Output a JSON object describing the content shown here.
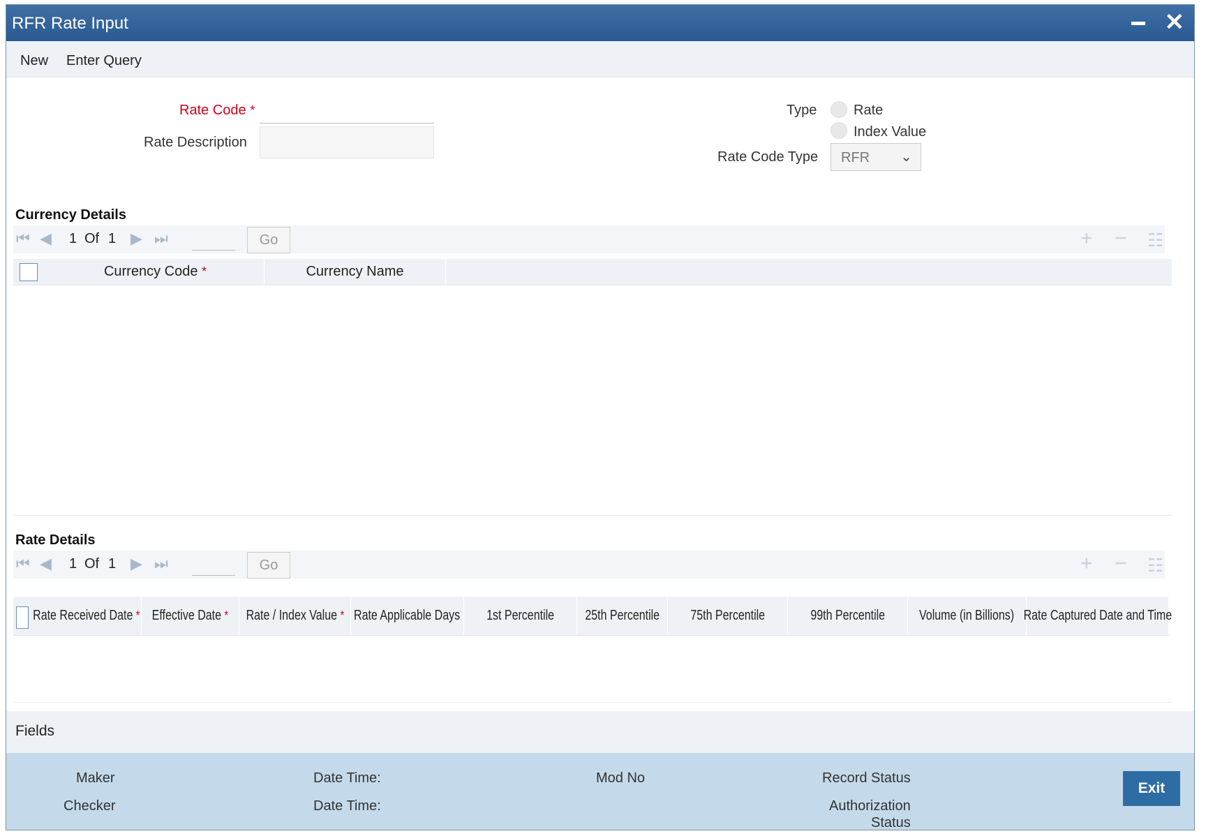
{
  "window": {
    "title": "RFR Rate Input"
  },
  "toolbar": {
    "new_label": "New",
    "enter_query_label": "Enter Query"
  },
  "form": {
    "rate_code_label": "Rate Code",
    "rate_code_value": "",
    "rate_description_label": "Rate Description",
    "rate_description_value": "",
    "type_label": "Type",
    "type_options": [
      "Rate",
      "Index Value"
    ],
    "rate_code_type_label": "Rate Code Type",
    "rate_code_type_value": "RFR"
  },
  "currency_details": {
    "title": "Currency Details",
    "pager": {
      "current": "1",
      "of_label": "Of",
      "total": "1",
      "go_label": "Go"
    },
    "columns": [
      "Currency Code",
      "Currency Name"
    ],
    "rows": []
  },
  "rate_details": {
    "title": "Rate Details",
    "pager": {
      "current": "1",
      "of_label": "Of",
      "total": "1",
      "go_label": "Go"
    },
    "columns": [
      "Rate Received Date",
      "Effective Date",
      "Rate / Index Value",
      "Rate Applicable Days",
      "1st Percentile",
      "25th Percentile",
      "75th Percentile",
      "99th Percentile",
      "Volume (in Billions)",
      "Rate Captured Date and Time"
    ],
    "rows": []
  },
  "fields": {
    "label": "Fields"
  },
  "audit": {
    "maker_label": "Maker",
    "checker_label": "Checker",
    "maker_datetime_label": "Date Time:",
    "checker_datetime_label": "Date Time:",
    "mod_no_label": "Mod No",
    "record_status_label": "Record Status",
    "authorization_status_label_1": "Authorization",
    "authorization_status_label_2": "Status"
  },
  "exit_label": "Exit",
  "colors": {
    "titlebar": "#2a5a92",
    "accent": "#2e6da4",
    "required": "#d0021b",
    "audit_bg": "#c4daea"
  }
}
